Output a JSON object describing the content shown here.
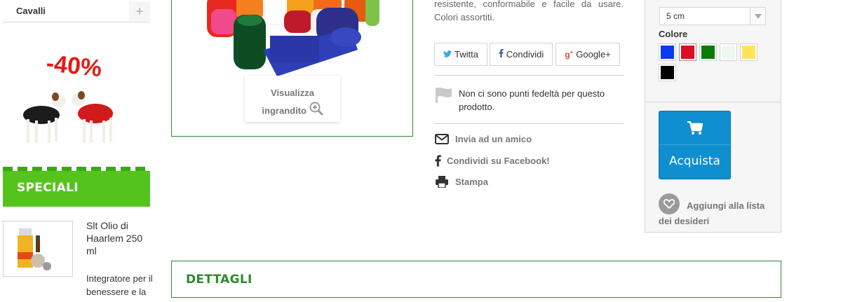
{
  "sidebar": {
    "category": {
      "label": "Cavalli",
      "toggle": "+"
    },
    "promo": {
      "discount": "-40%"
    },
    "specials": {
      "title": "SPECIALI",
      "item": {
        "name": "Slt Olio di Haarlem 250 ml",
        "description": "Integratore per il benessere e la"
      }
    }
  },
  "product": {
    "description": "resistente, conformabile e facile da usare. Colori assortiti.",
    "enlarge_label": "Visualizza ingrandito",
    "share": {
      "twitter": "Twitta",
      "facebook": "Condividi",
      "google": "Google+"
    },
    "loyalty": "Non ci sono punti fedeltà per questo prodotto.",
    "actions": {
      "email": "Invia ad un amico",
      "facebook": "Condividi su Facebook!",
      "print": "Stampa"
    }
  },
  "buy_box": {
    "size_selected": "5 cm",
    "color_label": "Colore",
    "colors": [
      "#0d39f2",
      "#dc0f22",
      "#0a7c0a",
      "#eef9ee",
      "#ffe45a",
      "#000000"
    ],
    "buy_button": "Acquista",
    "wishlist": "Aggiungi alla lista dei desideri"
  },
  "details": {
    "title": "DETTAGLI"
  },
  "colors": {
    "green_accent": "#2f8a2f",
    "speciali_bg": "#54c41d",
    "buy_button": "#0f8ed0"
  }
}
